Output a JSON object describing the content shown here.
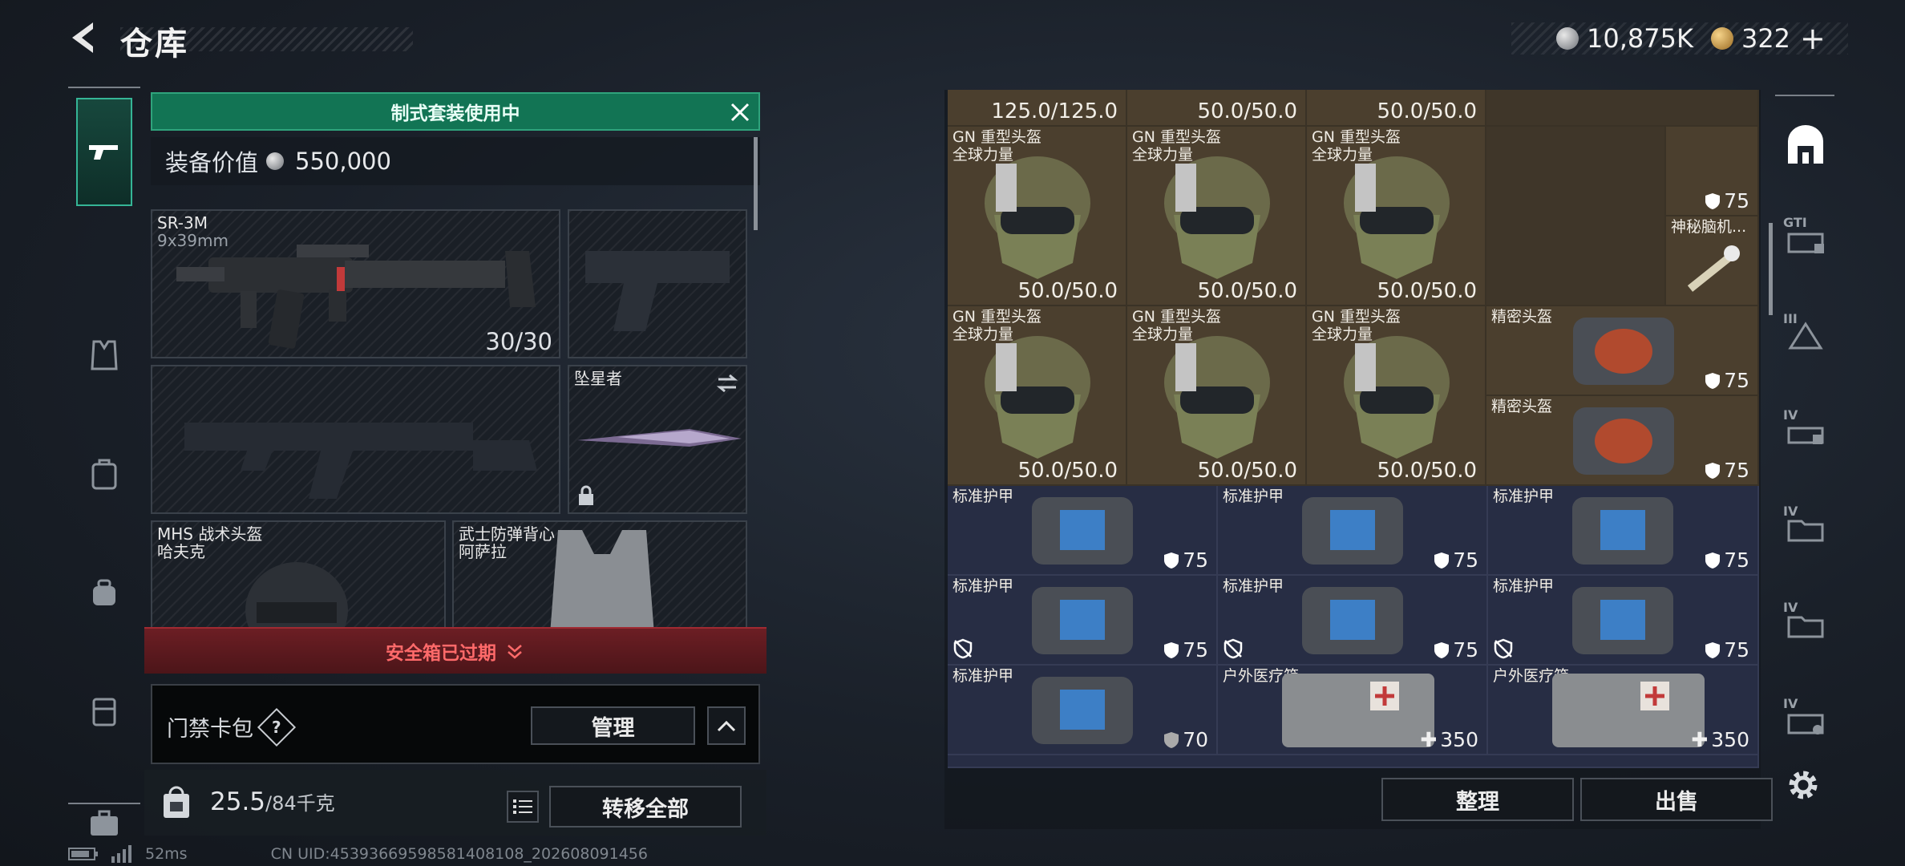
{
  "header": {
    "title": "仓库"
  },
  "currency": {
    "silver": "10,875K",
    "gold": "322",
    "add": "+"
  },
  "loadout": {
    "banner": "制式套装使用中",
    "equip_value_label": "装备价值",
    "equip_value": "550,000",
    "primary": {
      "name": "SR-3M",
      "caliber": "9x39mm",
      "ammo": "30/30"
    },
    "melee": {
      "name": "坠星者"
    },
    "helmet": {
      "name": "MHS 战术头盔",
      "sub": "哈夫克"
    },
    "vest": {
      "name": "武士防弹背心",
      "sub": "阿萨拉"
    },
    "safe_box": "安全箱已过期",
    "keycard": "门禁卡包",
    "help": "?",
    "manage": "管理",
    "weight": "25.5",
    "weight_cap": "/84千克",
    "transfer_all": "转移全部"
  },
  "stash": {
    "top_values": [
      "125.0/125.0",
      "50.0/50.0",
      "50.0/50.0"
    ],
    "helmet_name": "GN 重型头盔",
    "helmet_sub": "全球力量",
    "helmet_dur": "50.0/50.0",
    "side_shield": "75",
    "mystery": "神秘脑机...",
    "precision_helmet": "精密头盔",
    "precision_val": "75",
    "armor_name": "标准护甲",
    "armor_val": "75",
    "armor_val_low": "70",
    "medkit_name": "户外医疗箱",
    "medkit_val": "350",
    "sort": "整理",
    "sell": "出售"
  },
  "right_nav_tiers": [
    "GTI",
    "III",
    "IV",
    "IV",
    "IV",
    "IV"
  ],
  "status": {
    "ping": "52ms",
    "uid": "CN UID:45393669598581408108_202608091456"
  },
  "colors": {
    "accent_green": "#127454",
    "alert_red": "#ff6a6a",
    "helmet_bg": "#4b3f2e",
    "armor_bg": "#272d44"
  }
}
